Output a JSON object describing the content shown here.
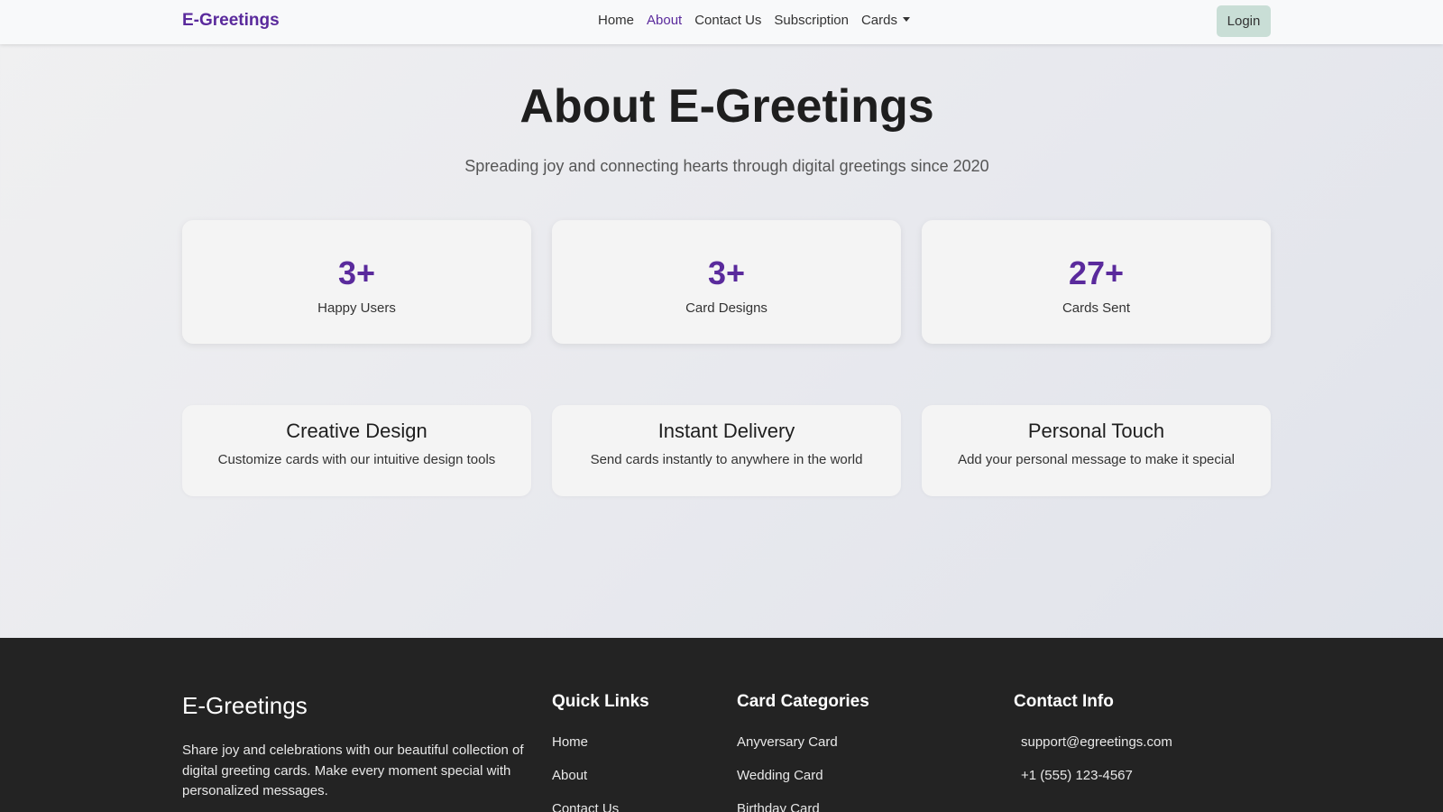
{
  "navbar": {
    "brand": "E-Greetings",
    "links": [
      {
        "label": "Home",
        "active": false
      },
      {
        "label": "About",
        "active": true
      },
      {
        "label": "Contact Us",
        "active": false
      },
      {
        "label": "Subscription",
        "active": false
      },
      {
        "label": "Cards",
        "active": false
      }
    ],
    "login_label": "Login"
  },
  "hero": {
    "title": "About E-Greetings",
    "subtitle": "Spreading joy and connecting hearts through digital greetings since 2020"
  },
  "stats": [
    {
      "value": "3+",
      "label": "Happy Users"
    },
    {
      "value": "3+",
      "label": "Card Designs"
    },
    {
      "value": "27+",
      "label": "Cards Sent"
    }
  ],
  "features": [
    {
      "title": "Creative Design",
      "description": "Customize cards with our intuitive design tools"
    },
    {
      "title": "Instant Delivery",
      "description": "Send cards instantly to anywhere in the world"
    },
    {
      "title": "Personal Touch",
      "description": "Add your personal message to make it special"
    }
  ],
  "footer": {
    "brand": "E-Greetings",
    "description": "Share joy and celebrations with our beautiful collection of digital greeting cards. Make every moment special with personalized messages.",
    "quick_links": {
      "heading": "Quick Links",
      "items": [
        "Home",
        "About",
        "Contact Us"
      ]
    },
    "categories": {
      "heading": "Card Categories",
      "items": [
        "Anyversary Card",
        "Wedding Card",
        "Birthday Card"
      ]
    },
    "contact": {
      "heading": "Contact Info",
      "email": "support@egreetings.com",
      "phone": "+1 (555) 123-4567"
    }
  },
  "colors": {
    "brand_purple": "#5a2a9c",
    "footer_bg": "#232323",
    "login_bg": "#c9ded6"
  }
}
